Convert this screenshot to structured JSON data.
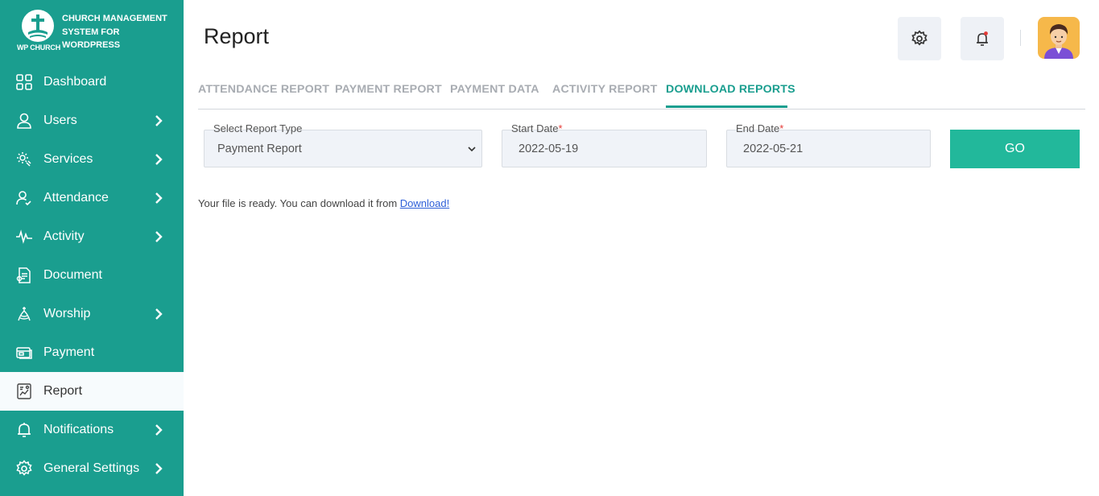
{
  "brand": {
    "logo_text": "WP CHURCH",
    "name_line1": "CHURCH MANAGEMENT",
    "name_line2": "SYSTEM FOR",
    "name_line3": "WORDPRESS"
  },
  "sidebar": {
    "items": [
      {
        "label": "Dashboard",
        "icon": "dashboard-icon",
        "has_submenu": false
      },
      {
        "label": "Users",
        "icon": "user-icon",
        "has_submenu": true
      },
      {
        "label": "Services",
        "icon": "services-icon",
        "has_submenu": true
      },
      {
        "label": "Attendance",
        "icon": "attendance-icon",
        "has_submenu": true
      },
      {
        "label": "Activity",
        "icon": "activity-icon",
        "has_submenu": true
      },
      {
        "label": "Document",
        "icon": "document-icon",
        "has_submenu": false
      },
      {
        "label": "Worship",
        "icon": "worship-icon",
        "has_submenu": true
      },
      {
        "label": "Payment",
        "icon": "payment-icon",
        "has_submenu": false
      },
      {
        "label": "Report",
        "icon": "report-icon",
        "has_submenu": false,
        "active": true
      },
      {
        "label": "Notifications",
        "icon": "bell-icon",
        "has_submenu": true
      },
      {
        "label": "General Settings",
        "icon": "gear-icon",
        "has_submenu": true
      }
    ]
  },
  "header": {
    "title": "Report",
    "settings_icon": "gear-icon",
    "notifications_icon": "bell-icon",
    "avatar_icon": "user-avatar"
  },
  "tabs": [
    {
      "label": "ATTENDANCE REPORT"
    },
    {
      "label": "PAYMENT REPORT"
    },
    {
      "label": "PAYMENT DATA"
    },
    {
      "label": "ACTIVITY REPORT"
    },
    {
      "label": "DOWNLOAD REPORTS",
      "active": true
    }
  ],
  "form": {
    "report_type_label": "Select Report Type",
    "report_type_value": "Payment Report",
    "start_date_label": "Start Date",
    "start_date_value": "2022-05-19",
    "end_date_label": "End Date",
    "end_date_value": "2022-05-21",
    "required_mark": "*",
    "go_label": "GO"
  },
  "message": {
    "text": "Your file is ready. You can download it from ",
    "link": "Download!"
  },
  "colors": {
    "sidebar_bg": "#1a9e8f",
    "accent": "#1a9e8f",
    "go_button": "#22b89b",
    "active_nav_bg": "#f7fbfd",
    "notification_dot": "#e53935"
  }
}
